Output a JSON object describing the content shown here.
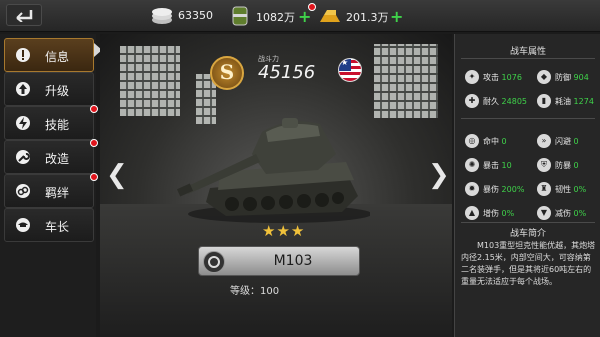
{
  "resources": [
    {
      "icon": "silver-coins-icon",
      "value": "63350",
      "has_plus": false
    },
    {
      "icon": "fuel-barrel-icon",
      "value": "1082万",
      "has_plus": true,
      "has_dot": true
    },
    {
      "icon": "gold-bars-icon",
      "value": "201.3万",
      "has_plus": true
    }
  ],
  "menu": {
    "items": [
      {
        "label": "信息",
        "icon": "info-icon",
        "active": true,
        "dot": false
      },
      {
        "label": "升级",
        "icon": "upgrade-arrow-icon",
        "active": false,
        "dot": false
      },
      {
        "label": "技能",
        "icon": "lightning-icon",
        "active": false,
        "dot": true
      },
      {
        "label": "改造",
        "icon": "wrench-icon",
        "active": false,
        "dot": true
      },
      {
        "label": "羁绊",
        "icon": "link-icon",
        "active": false,
        "dot": true
      },
      {
        "label": "车长",
        "icon": "commander-icon",
        "active": false,
        "dot": false
      }
    ]
  },
  "tank": {
    "rank": "S",
    "power_label": "战斗力",
    "power": "45156",
    "flag": "usa-flag-icon",
    "stars": "★★★",
    "name": "M103",
    "level_text": "等级：100"
  },
  "attributes": {
    "title": "战车属性",
    "stats": [
      {
        "icon": "attack-icon",
        "label": "攻击",
        "value": "1076"
      },
      {
        "icon": "defense-icon",
        "label": "防御",
        "value": "904"
      },
      {
        "icon": "durability-icon",
        "label": "耐久",
        "value": "24805"
      },
      {
        "icon": "fuel-icon",
        "label": "耗油",
        "value": "1274"
      },
      {
        "icon": "hit-icon",
        "label": "命中",
        "value": "0"
      },
      {
        "icon": "dodge-icon",
        "label": "闪避",
        "value": "0"
      },
      {
        "icon": "crit-icon",
        "label": "暴击",
        "value": "10"
      },
      {
        "icon": "anti-crit-icon",
        "label": "防暴",
        "value": "0"
      },
      {
        "icon": "crit-damage-icon",
        "label": "暴伤",
        "value": "200%"
      },
      {
        "icon": "toughness-icon",
        "label": "韧性",
        "value": "0%"
      },
      {
        "icon": "damage-up-icon",
        "label": "增伤",
        "value": "0%"
      },
      {
        "icon": "damage-down-icon",
        "label": "减伤",
        "value": "0%"
      }
    ]
  },
  "intro": {
    "title": "战车简介",
    "text": "M103重型坦克性能优越，其炮塔内径2.15米，内部空间大，可容纳第二名装弹手，但是其将近60吨左右的重量无法适应于每个战场。"
  }
}
